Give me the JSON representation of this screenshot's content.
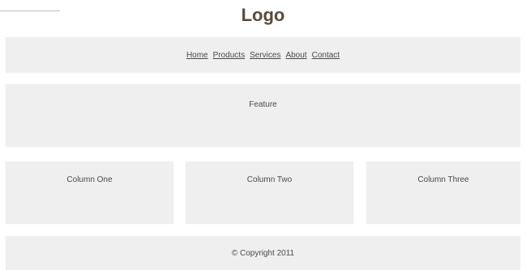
{
  "header": {
    "logo_text": "Logo"
  },
  "nav": {
    "items": [
      {
        "label": "Home"
      },
      {
        "label": "Products"
      },
      {
        "label": "Services"
      },
      {
        "label": "About"
      },
      {
        "label": "Contact"
      }
    ]
  },
  "feature": {
    "label": "Feature"
  },
  "columns": [
    {
      "label": "Column One"
    },
    {
      "label": "Column Two"
    },
    {
      "label": "Column Three"
    }
  ],
  "footer": {
    "copyright": "© Copyright 2011"
  },
  "colors": {
    "panel_background": "#efefef",
    "logo_color": "#5a4a3c",
    "text_color": "#4a4a4a"
  }
}
